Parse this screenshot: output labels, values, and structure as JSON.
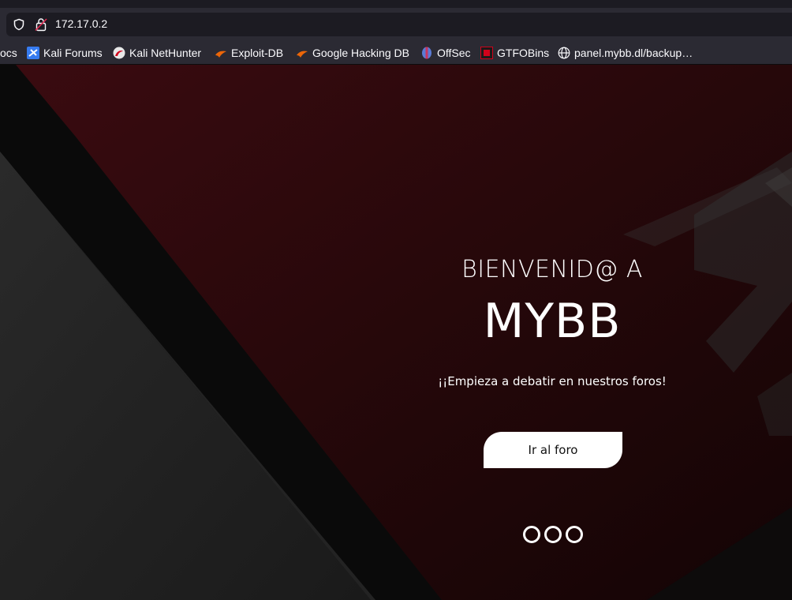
{
  "browser": {
    "url": "172.17.0.2",
    "bookmarks": [
      {
        "label": "ocs",
        "icon": "docs-icon"
      },
      {
        "label": "Kali Forums",
        "icon": "kali-forums-icon"
      },
      {
        "label": "Kali NetHunter",
        "icon": "kali-nethunter-icon"
      },
      {
        "label": "Exploit-DB",
        "icon": "exploit-db-icon"
      },
      {
        "label": "Google Hacking DB",
        "icon": "ghdb-icon"
      },
      {
        "label": "OffSec",
        "icon": "offsec-icon"
      },
      {
        "label": "GTFOBins",
        "icon": "gtfobins-icon"
      },
      {
        "label": "panel.mybb.dl/backup…",
        "icon": "globe-icon"
      }
    ]
  },
  "hero": {
    "welcome": "BIENVENID@ A",
    "brand": "MYBB",
    "tagline": "¡¡Empieza a debatir en nuestros foros!",
    "cta_label": "Ir al foro",
    "slides": 3
  },
  "colors": {
    "accent": "#c8102e",
    "chrome_bg": "#2b2a33",
    "urlbar_bg": "#1c1b22",
    "hero_red": "#2a0a0c"
  }
}
